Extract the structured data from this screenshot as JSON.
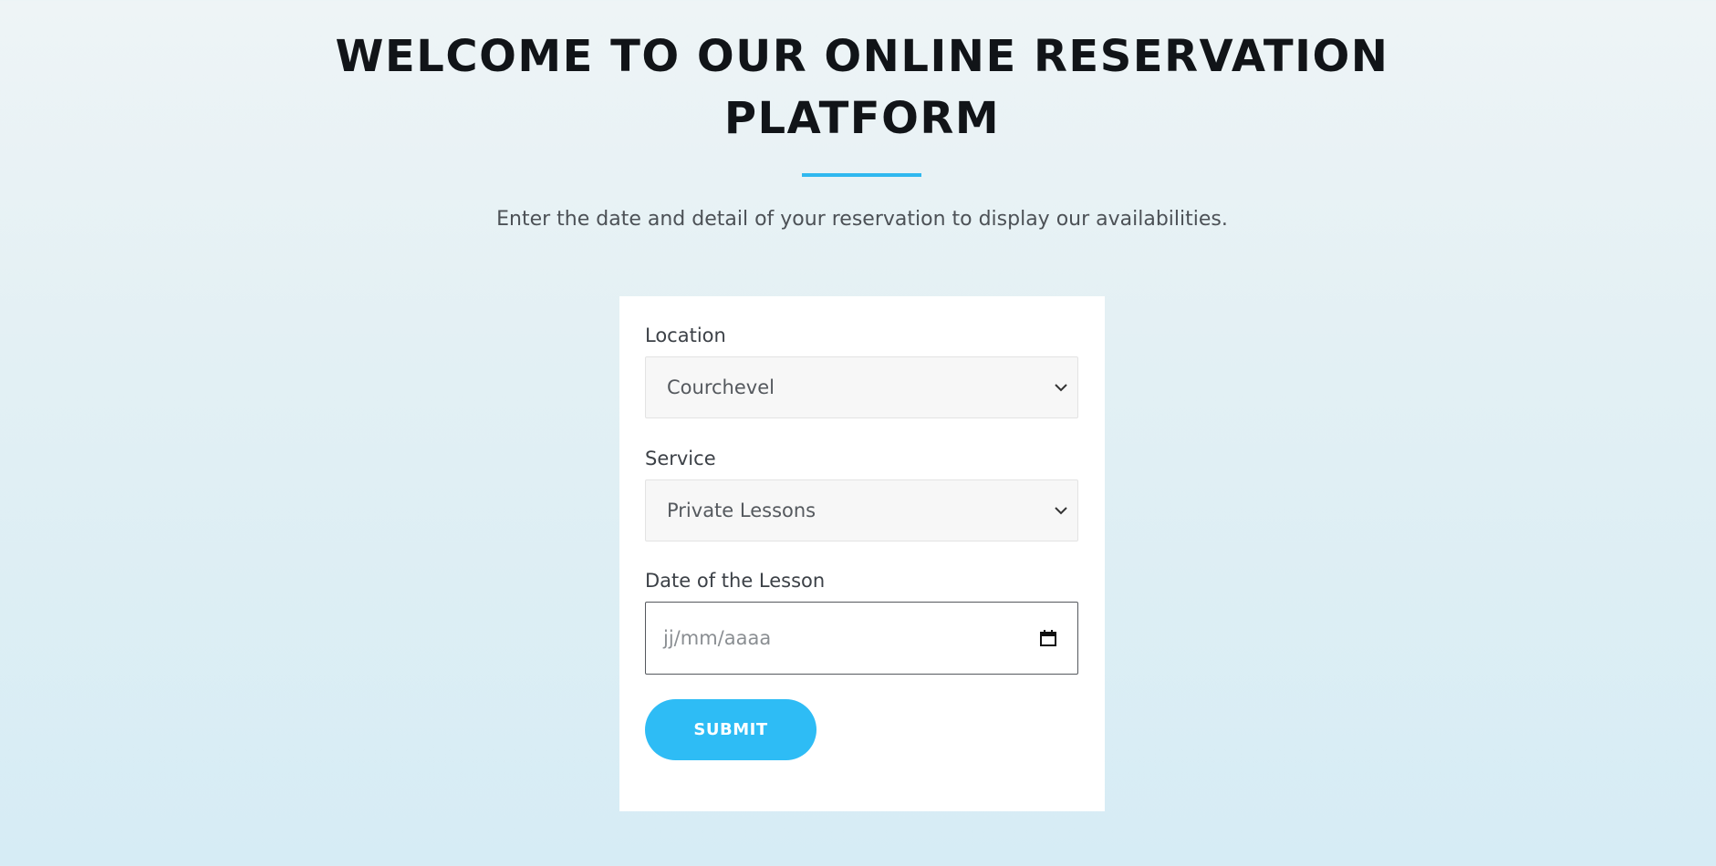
{
  "hero": {
    "title_line1": "WELCOME TO OUR ONLINE RESERVATION",
    "title_line2": "PLATFORM",
    "subtitle": "Enter the date and detail of your reservation to display our availabilities."
  },
  "form": {
    "location": {
      "label": "Location",
      "value": "Courchevel"
    },
    "service": {
      "label": "Service",
      "value": "Private Lessons"
    },
    "date": {
      "label": "Date of the Lesson",
      "placeholder": "jj/mm/aaaa"
    },
    "submit_label": "SUBMIT"
  },
  "colors": {
    "accent": "#2ebcf5",
    "title": "#111418",
    "text": "#4c5156",
    "card": "#ffffff"
  },
  "icons": {
    "select_arrow": "chevron-down-icon",
    "date_picker": "calendar-icon"
  }
}
